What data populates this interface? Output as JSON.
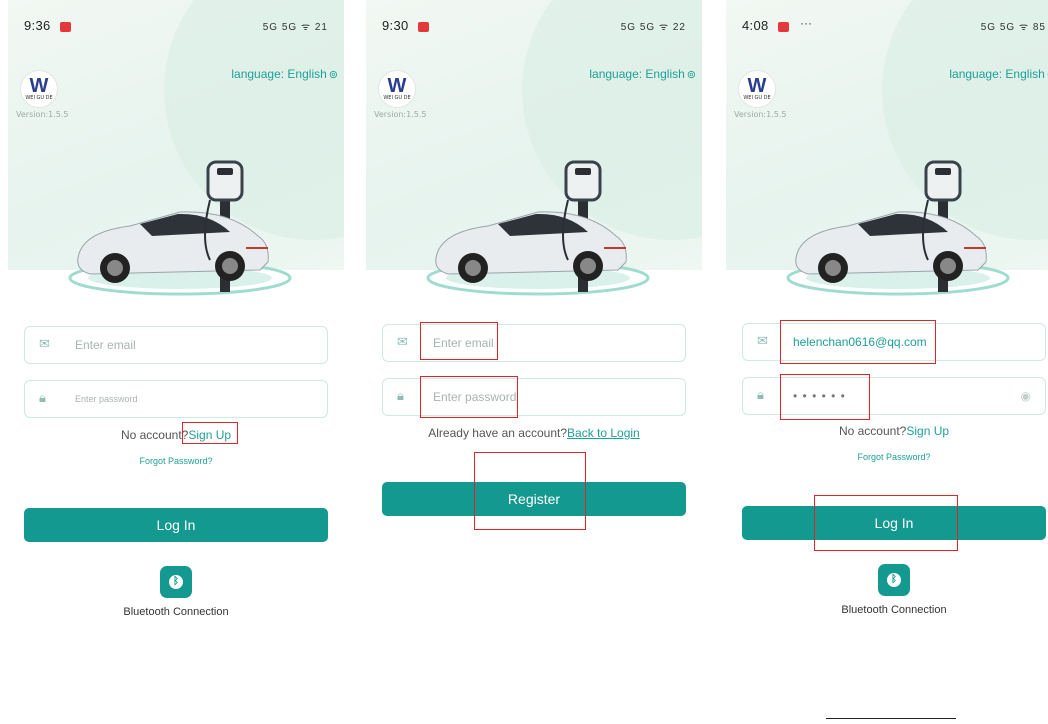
{
  "screens": [
    {
      "time": "9:36",
      "status_extra": "",
      "signal": "5G 5G ᯤ 21",
      "language_label": "language:",
      "language_value": "English",
      "version": "Version:1.5.5",
      "logo_brand": "WEI GU DE",
      "email_placeholder": "Enter email",
      "password_placeholder": "Enter password",
      "prompt_text": "No account?",
      "prompt_link": "Sign Up",
      "forgot": "Forgot Password?",
      "button": "Log In",
      "bluetooth": "Bluetooth Connection"
    },
    {
      "time": "9:30",
      "status_extra": "",
      "signal": "5G 5G ᯤ 22",
      "language_label": "language:",
      "language_value": "English",
      "version": "Version:1.5.5",
      "logo_brand": "WEI GU DE",
      "email_placeholder": "Enter email",
      "password_placeholder": "Enter password",
      "prompt_text": "Already have an account?",
      "prompt_link": "Back to Login",
      "button": "Register"
    },
    {
      "time": "4:08",
      "status_extra": "···",
      "signal": "5G 5G ᯤ 85",
      "language_label": "language:",
      "language_value": "English",
      "version": "Version:1.5.5",
      "logo_brand": "WEI GU DE",
      "email_value": "helenchan0616@qq.com",
      "password_value": "• • • • • •",
      "prompt_text": "No account?",
      "prompt_link": "Sign Up",
      "forgot": "Forgot Password?",
      "button": "Log In",
      "bluetooth": "Bluetooth Connection"
    }
  ],
  "colors": {
    "accent": "#13998f",
    "link": "#1e9f97",
    "highlight": "#e0242c"
  },
  "icons": {
    "email": "mail-icon",
    "password": "lock-icon",
    "eye": "eye-icon",
    "bluetooth": "bluetooth-icon",
    "language": "globe-icon"
  }
}
